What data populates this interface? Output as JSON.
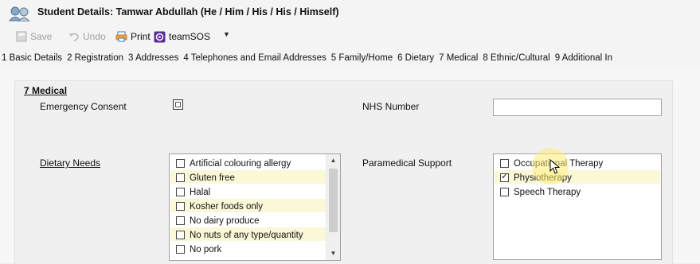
{
  "window": {
    "title": "Student Details: Tamwar Abdullah (He / Him / His / His / Himself)"
  },
  "toolbar": {
    "save_label": "Save",
    "undo_label": "Undo",
    "print_label": "Print",
    "teamsos_label": "teamSOS"
  },
  "tabs": [
    {
      "label": "1 Basic Details"
    },
    {
      "label": "2 Registration"
    },
    {
      "label": "3 Addresses"
    },
    {
      "label": "4 Telephones and Email Addresses"
    },
    {
      "label": "5 Family/Home"
    },
    {
      "label": "6 Dietary"
    },
    {
      "label": "7 Medical"
    },
    {
      "label": "8 Ethnic/Cultural"
    },
    {
      "label": "9 Additional In"
    }
  ],
  "medical": {
    "section_title": "7 Medical",
    "emergency_consent_label": "Emergency Consent",
    "nhs_number_label": "NHS Number",
    "nhs_number_value": "",
    "dietary_needs_label": "Dietary Needs",
    "paramedical_support_label": "Paramedical Support",
    "dietary_items": [
      {
        "label": "Artificial colouring allergy",
        "checked": false
      },
      {
        "label": "Gluten free",
        "checked": false
      },
      {
        "label": "Halal",
        "checked": false
      },
      {
        "label": "Kosher foods only",
        "checked": false
      },
      {
        "label": "No dairy produce",
        "checked": false
      },
      {
        "label": "No nuts of any type/quantity",
        "checked": false
      },
      {
        "label": "No pork",
        "checked": false
      }
    ],
    "paramedical_items": [
      {
        "label": "Occupational Therapy",
        "checked": false
      },
      {
        "label": "Physiotherapy",
        "checked": true
      },
      {
        "label": "Speech Therapy",
        "checked": false
      }
    ]
  },
  "colors": {
    "row_highlight": "#fbf8d8",
    "cursor_highlight": "#ffec78"
  }
}
